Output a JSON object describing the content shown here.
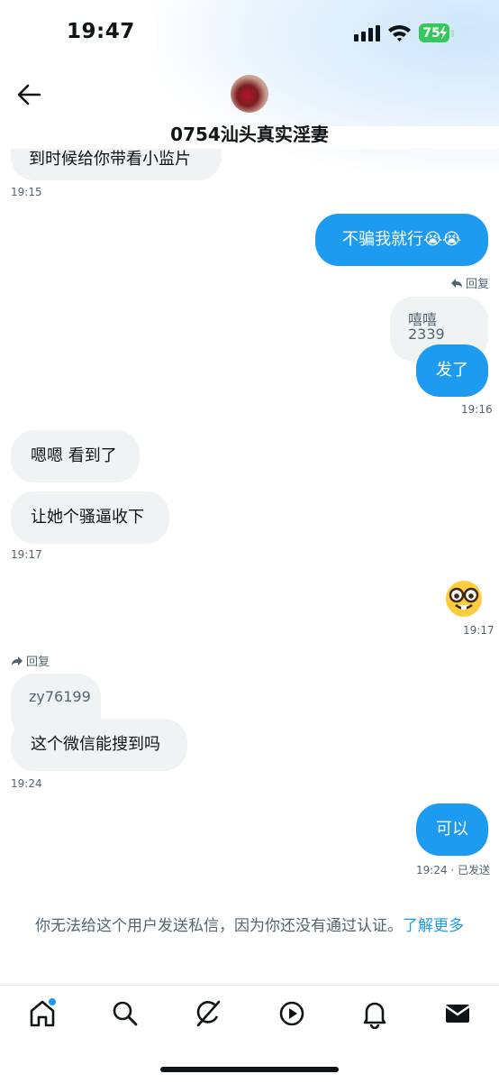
{
  "status_bar": {
    "time": "19:47",
    "battery": "75"
  },
  "header": {
    "title": "0754汕头真实淫妻"
  },
  "messages": {
    "cut_off_text": "到时候给你带看小监片",
    "ts_1915": "19:15",
    "out_1": "不骗我就行😭😭",
    "reply_label_out": "回复",
    "quote_out": "嘻嘻2339",
    "out_2": "发了",
    "ts_1916": "19:16",
    "in_1": "嗯嗯 看到了",
    "in_2": "让她个骚逼收下",
    "ts_1917a": "19:17",
    "emoji_name": "nerd-face",
    "ts_1917b": "19:17",
    "reply_label_in": "回复",
    "quote_in": "zy76199",
    "in_3": "这个微信能搜到吗",
    "ts_1924a": "19:24",
    "out_3": "可以",
    "ts_1924b": "19:24 · 已发送"
  },
  "notice": {
    "text": "你无法给这个用户发送私信，因为你还没有通过认证。",
    "link": "了解更多"
  },
  "tabs": [
    {
      "icon": "home-icon"
    },
    {
      "icon": "search-icon"
    },
    {
      "icon": "grok-icon"
    },
    {
      "icon": "video-play-icon"
    },
    {
      "icon": "bell-icon"
    },
    {
      "icon": "mail-icon"
    }
  ],
  "colors": {
    "accent": "#1d9bf0",
    "bubble_in": "#eff3f4",
    "battery": "#34c759"
  }
}
